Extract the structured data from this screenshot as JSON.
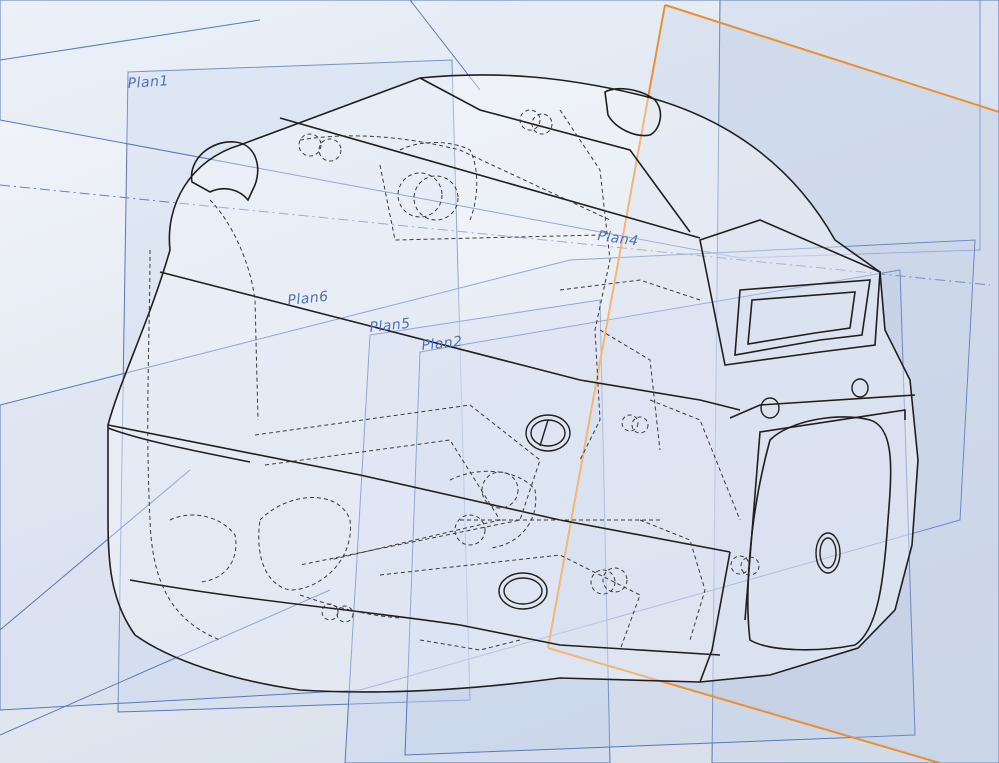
{
  "app": {
    "view": "3D model viewport (CAD wireframe / transparent view)"
  },
  "colors": {
    "plane_outline": "#5d76b6",
    "plane_fill": "#c8d6ee",
    "active_plane": "#f08a1c",
    "body_edge": "#1f1f1f",
    "hidden_edge": "#3a3a3a",
    "label": "#4f6fbf"
  },
  "planes": [
    {
      "id": "plan1",
      "label": "Plan1"
    },
    {
      "id": "plan6",
      "label": "Plan6"
    },
    {
      "id": "plan5",
      "label": "Plan5"
    },
    {
      "id": "plan2",
      "label": "Plan2"
    },
    {
      "id": "plan4",
      "label": "Plan4"
    }
  ]
}
